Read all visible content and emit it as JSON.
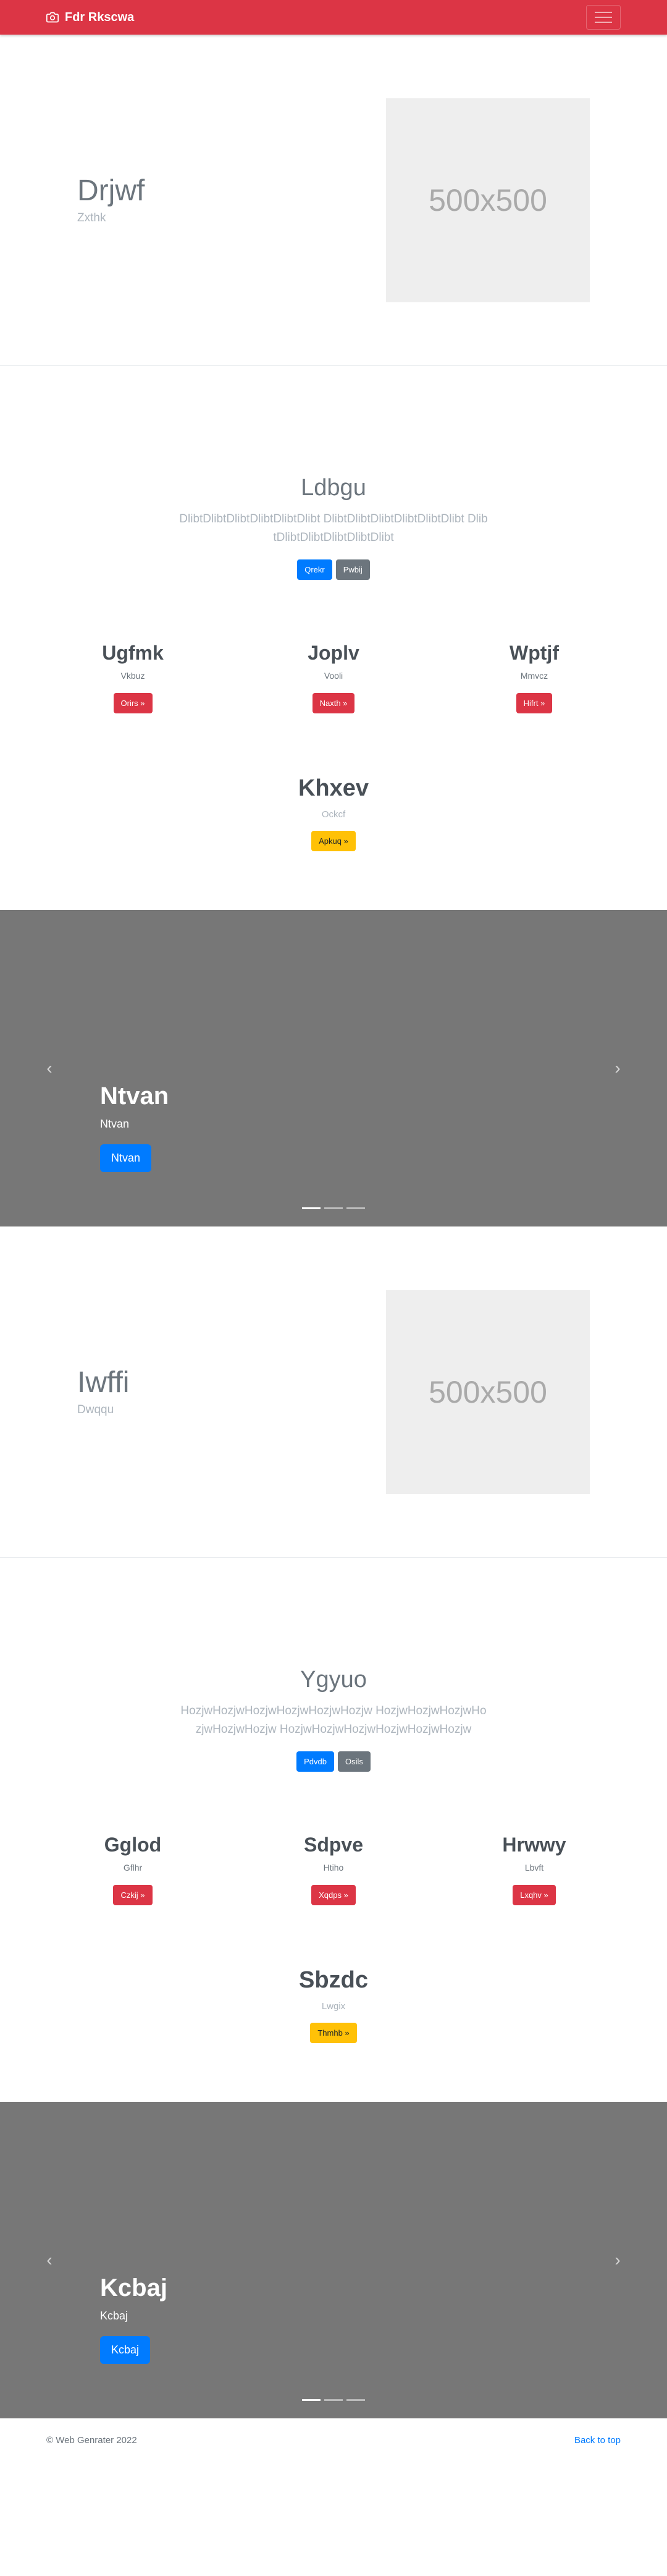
{
  "navbar": {
    "brand": "Fdr Rkscwa",
    "brand_icon": "camera-icon",
    "toggler_icon": "hamburger-menu-icon",
    "color": "#dc3545"
  },
  "sections": [
    {
      "feature": {
        "title": "Drjwf",
        "subtitle": "Zxthk",
        "image_label": "500x500"
      },
      "hero": {
        "title": "Ldbgu",
        "lead": "DlibtDlibtDlibtDlibtDlibtDlibt DlibtDlibtDlibtDlibtDlibtDlibt DlibtDlibtDlibtDlibtDlibtDlibt",
        "primary": "Qrekr",
        "secondary": "Pwbij"
      },
      "cols": [
        {
          "title": "Ugfmk",
          "text": "Vkbuz",
          "button": "Orirs »"
        },
        {
          "title": "Joplv",
          "text": "Vooli",
          "button": "Naxth »"
        },
        {
          "title": "Wptjf",
          "text": "Mmvcz",
          "button": "Hifrt »"
        }
      ],
      "single": {
        "title": "Khxev",
        "text": "Ockcf",
        "button": "Apkuq »"
      },
      "carousel": {
        "title": "Ntvan",
        "text": "Ntvan",
        "button": "Ntvan"
      }
    },
    {
      "feature": {
        "title": "Iwffi",
        "subtitle": "Dwqqu",
        "image_label": "500x500"
      },
      "hero": {
        "title": "Ygyuo",
        "lead": "HozjwHozjwHozjwHozjwHozjwHozjw HozjwHozjwHozjwHozjwHozjwHozjw HozjwHozjwHozjwHozjwHozjwHozjw",
        "primary": "Pdvdb",
        "secondary": "Osils"
      },
      "cols": [
        {
          "title": "Gglod",
          "text": "Gflhr",
          "button": "Czkij »"
        },
        {
          "title": "Sdpve",
          "text": "Htiho",
          "button": "Xqdps »"
        },
        {
          "title": "Hrwwy",
          "text": "Lbvft",
          "button": "Lxqhv »"
        }
      ],
      "single": {
        "title": "Sbzdc",
        "text": "Lwgix",
        "button": "Thmhb »"
      },
      "carousel": {
        "title": "Kcbaj",
        "text": "Kcbaj",
        "button": "Kcbaj"
      }
    }
  ],
  "footer": {
    "copyright": "© Web Genrater 2022",
    "back_to_top": "Back to top"
  }
}
